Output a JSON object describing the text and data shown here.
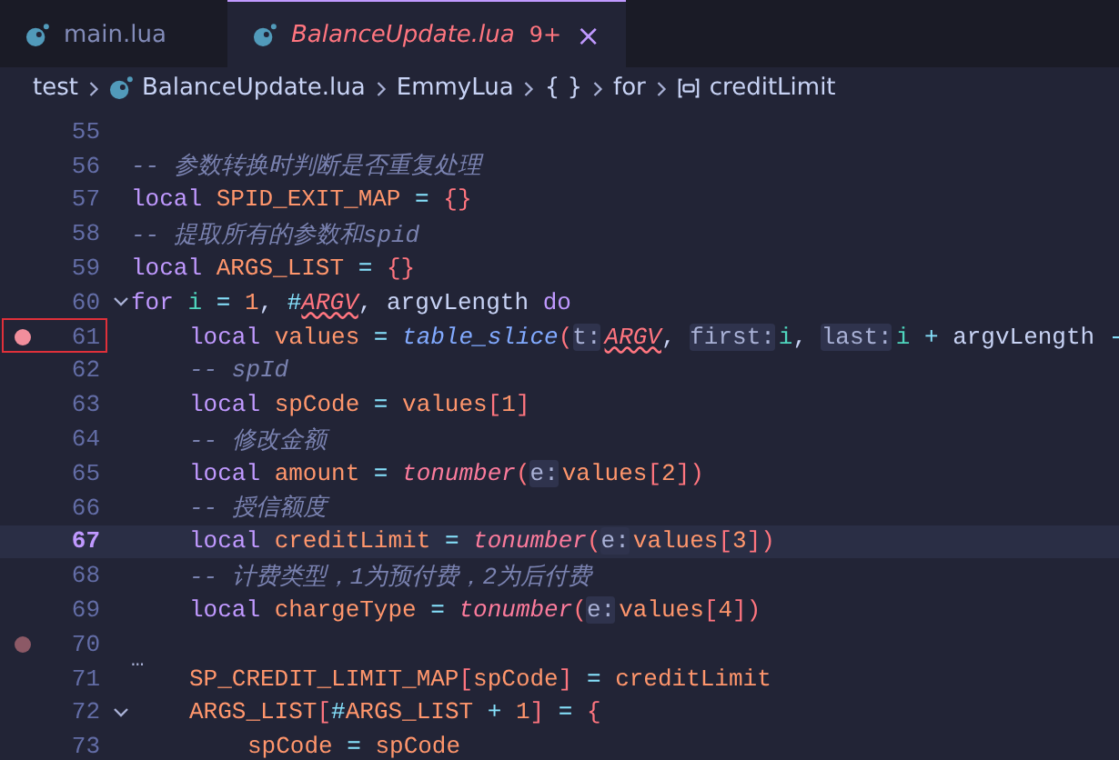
{
  "tabs": [
    {
      "label": "main.lua",
      "selected": false,
      "modified": false
    },
    {
      "label": "BalanceUpdate.lua",
      "selected": true,
      "modified": true,
      "badge": "9+",
      "close": "×"
    }
  ],
  "breadcrumb": [
    {
      "kind": "folder",
      "text": "test"
    },
    {
      "kind": "file",
      "text": "BalanceUpdate.lua"
    },
    {
      "kind": "plain",
      "text": "EmmyLua"
    },
    {
      "kind": "plain",
      "text": "{ }"
    },
    {
      "kind": "plain",
      "text": "for"
    },
    {
      "kind": "variable",
      "text": "creditLimit"
    }
  ],
  "lines": [
    {
      "number": "55",
      "breakpoint": false,
      "current": false,
      "boxed": false
    },
    {
      "number": "56",
      "breakpoint": false,
      "current": false,
      "boxed": false,
      "tokens": [
        {
          "kind": "comment",
          "text": "-- 参数转换时判断是否重复处理"
        }
      ]
    },
    {
      "number": "57",
      "breakpoint": false,
      "current": false,
      "boxed": false,
      "tokens": [
        {
          "kind": "kw",
          "text": "local "
        },
        {
          "kind": "var",
          "text": "SPID_EXIT_MAP "
        },
        {
          "kind": "op",
          "text": "= "
        },
        {
          "kind": "punc",
          "text": "{}"
        }
      ]
    },
    {
      "number": "58",
      "breakpoint": false,
      "current": false,
      "boxed": false,
      "tokens": [
        {
          "kind": "comment",
          "text": "-- 提取所有的参数和spid"
        }
      ]
    },
    {
      "number": "59",
      "breakpoint": false,
      "current": false,
      "boxed": false,
      "tokens": [
        {
          "kind": "kw",
          "text": "local "
        },
        {
          "kind": "var",
          "text": "ARGS_LIST "
        },
        {
          "kind": "op",
          "text": "= "
        },
        {
          "kind": "punc",
          "text": "{}"
        }
      ]
    },
    {
      "number": "60",
      "breakpoint": false,
      "current": false,
      "boxed": false,
      "expanded": true,
      "tokens": [
        {
          "kind": "kw",
          "text": "for "
        },
        {
          "kind": "loop",
          "text": "i "
        },
        {
          "kind": "op",
          "text": "= "
        },
        {
          "kind": "num",
          "text": "1"
        },
        {
          "kind": "plain",
          "text": ", "
        },
        {
          "kind": "op",
          "text": "#"
        },
        {
          "kind": "err",
          "text": "ARGV"
        },
        {
          "kind": "plain",
          "text": ", argvLength "
        },
        {
          "kind": "kw",
          "text": "do"
        }
      ],
      "children": [
        {
          "number": "61",
          "breakpoint": true,
          "current": false,
          "boxed": true,
          "tokens": [
            {
              "kind": "kw",
              "text": "local "
            },
            {
              "kind": "var",
              "text": "values "
            },
            {
              "kind": "op",
              "text": "= "
            },
            {
              "kind": "fn",
              "text": "table_slice"
            },
            {
              "kind": "punc",
              "text": "("
            },
            {
              "kind": "hint",
              "text": "t:"
            },
            {
              "kind": "err",
              "text": "ARGV"
            },
            {
              "kind": "plain",
              "text": ", "
            },
            {
              "kind": "hint",
              "text": "first:"
            },
            {
              "kind": "loop",
              "text": "i"
            },
            {
              "kind": "plain",
              "text": ", "
            },
            {
              "kind": "hint",
              "text": "last:"
            },
            {
              "kind": "loop",
              "text": "i "
            },
            {
              "kind": "op",
              "text": "+ "
            },
            {
              "kind": "plain",
              "text": "argvLength "
            },
            {
              "kind": "op",
              "text": "-"
            }
          ]
        },
        {
          "number": "62",
          "breakpoint": false,
          "current": false,
          "boxed": false,
          "tokens": [
            {
              "kind": "comment",
              "text": "-- spId"
            }
          ]
        },
        {
          "number": "63",
          "breakpoint": false,
          "current": false,
          "boxed": false,
          "tokens": [
            {
              "kind": "kw",
              "text": "local "
            },
            {
              "kind": "var",
              "text": "spCode "
            },
            {
              "kind": "op",
              "text": "= "
            },
            {
              "kind": "var",
              "text": "values"
            },
            {
              "kind": "punc",
              "text": "["
            },
            {
              "kind": "num",
              "text": "1"
            },
            {
              "kind": "punc",
              "text": "]"
            }
          ]
        },
        {
          "number": "64",
          "breakpoint": false,
          "current": false,
          "boxed": false,
          "tokens": [
            {
              "kind": "comment",
              "text": "-- 修改金额"
            }
          ]
        },
        {
          "number": "65",
          "breakpoint": false,
          "current": false,
          "boxed": false,
          "tokens": [
            {
              "kind": "kw",
              "text": "local "
            },
            {
              "kind": "var",
              "text": "amount "
            },
            {
              "kind": "op",
              "text": "= "
            },
            {
              "kind": "call",
              "text": "tonumber"
            },
            {
              "kind": "punc",
              "text": "("
            },
            {
              "kind": "hint",
              "text": "e:"
            },
            {
              "kind": "var",
              "text": "values"
            },
            {
              "kind": "punc",
              "text": "["
            },
            {
              "kind": "num",
              "text": "2"
            },
            {
              "kind": "punc",
              "text": "])"
            }
          ]
        },
        {
          "number": "66",
          "breakpoint": false,
          "current": false,
          "boxed": false,
          "tokens": [
            {
              "kind": "comment",
              "text": "-- 授信额度"
            }
          ]
        },
        {
          "number": "67",
          "breakpoint": false,
          "current": true,
          "boxed": false,
          "tokens": [
            {
              "kind": "kw",
              "text": "local "
            },
            {
              "kind": "var",
              "text": "creditLimit "
            },
            {
              "kind": "op",
              "text": "= "
            },
            {
              "kind": "call",
              "text": "tonumber"
            },
            {
              "kind": "punc",
              "text": "("
            },
            {
              "kind": "hint",
              "text": "e:"
            },
            {
              "kind": "var",
              "text": "values"
            },
            {
              "kind": "punc",
              "text": "["
            },
            {
              "kind": "num",
              "text": "3"
            },
            {
              "kind": "punc",
              "text": "])"
            }
          ]
        },
        {
          "number": "68",
          "breakpoint": false,
          "current": false,
          "boxed": false,
          "tokens": [
            {
              "kind": "comment",
              "text": "-- 计费类型，1为预付费，2为后付费"
            }
          ]
        },
        {
          "number": "69",
          "breakpoint": false,
          "current": false,
          "boxed": false,
          "tokens": [
            {
              "kind": "kw",
              "text": "local "
            },
            {
              "kind": "var",
              "text": "chargeType "
            },
            {
              "kind": "op",
              "text": "= "
            },
            {
              "kind": "call",
              "text": "tonumber"
            },
            {
              "kind": "punc",
              "text": "("
            },
            {
              "kind": "hint",
              "text": "e:"
            },
            {
              "kind": "var",
              "text": "values"
            },
            {
              "kind": "punc",
              "text": "["
            },
            {
              "kind": "num",
              "text": "4"
            },
            {
              "kind": "punc",
              "text": "])"
            }
          ]
        },
        {
          "number": "70",
          "breakpoint": true,
          "faded": true,
          "current": false,
          "boxed": false,
          "ellipsis": "…"
        },
        {
          "number": "71",
          "breakpoint": false,
          "current": false,
          "boxed": false,
          "tokens": [
            {
              "kind": "var",
              "text": "SP_CREDIT_LIMIT_MAP"
            },
            {
              "kind": "punc",
              "text": "["
            },
            {
              "kind": "var",
              "text": "spCode"
            },
            {
              "kind": "punc",
              "text": "] "
            },
            {
              "kind": "op",
              "text": "= "
            },
            {
              "kind": "var",
              "text": "creditLimit"
            }
          ]
        },
        {
          "number": "72",
          "breakpoint": false,
          "current": false,
          "boxed": false,
          "expanded": true,
          "tokens": [
            {
              "kind": "var",
              "text": "ARGS_LIST"
            },
            {
              "kind": "punc",
              "text": "["
            },
            {
              "kind": "op",
              "text": "#"
            },
            {
              "kind": "var",
              "text": "ARGS_LIST "
            },
            {
              "kind": "op",
              "text": "+ "
            },
            {
              "kind": "num",
              "text": "1"
            },
            {
              "kind": "punc",
              "text": "] "
            },
            {
              "kind": "op",
              "text": "= "
            },
            {
              "kind": "punc",
              "text": "{"
            }
          ],
          "children": [
            {
              "number": "73",
              "breakpoint": false,
              "current": false,
              "boxed": false,
              "tokens": [
                {
                  "kind": "var",
                  "text": "spCode "
                },
                {
                  "kind": "op",
                  "text": "= "
                },
                {
                  "kind": "var",
                  "text": "spCode"
                }
              ]
            }
          ]
        }
      ]
    }
  ]
}
